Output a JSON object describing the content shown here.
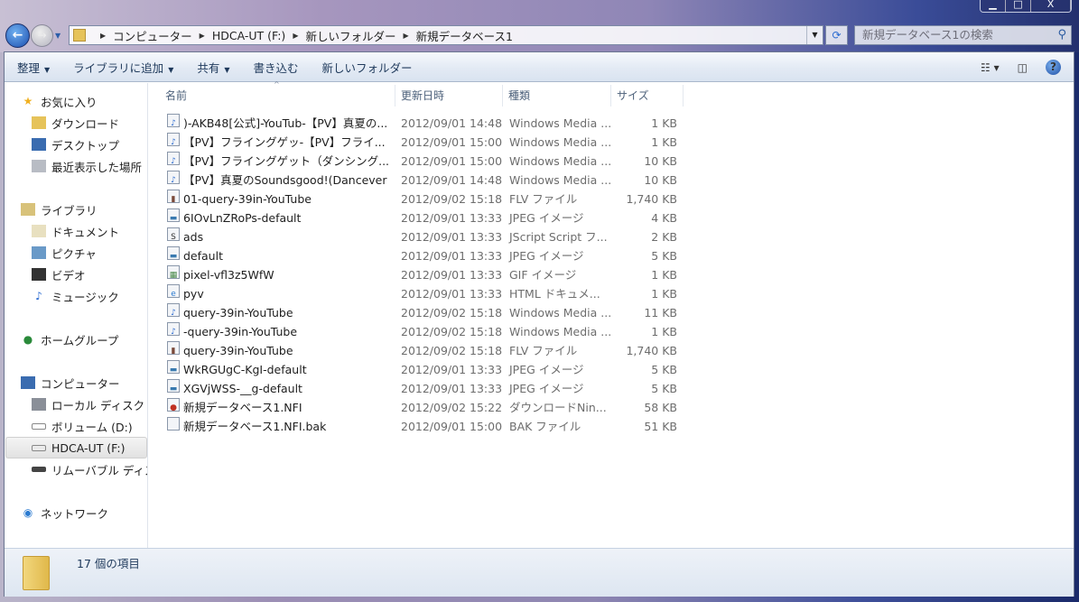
{
  "window": {
    "minimize": "▁",
    "maximize": "□",
    "close": "X"
  },
  "address": {
    "crumbs": [
      "コンピューター",
      "HDCA-UT (F:)",
      "新しいフォルダー",
      "新規データベース1"
    ]
  },
  "search": {
    "placeholder": "新規データベース1の検索"
  },
  "toolbar": {
    "organize": "整理",
    "add_library": "ライブラリに追加",
    "share": "共有",
    "burn": "書き込む",
    "new_folder": "新しいフォルダー"
  },
  "nav": {
    "favorites": "お気に入り",
    "downloads": "ダウンロード",
    "desktop": "デスクトップ",
    "recent": "最近表示した場所",
    "libraries": "ライブラリ",
    "documents": "ドキュメント",
    "pictures": "ピクチャ",
    "videos": "ビデオ",
    "music": "ミュージック",
    "homegroup": "ホームグループ",
    "computer": "コンピューター",
    "local_disk": "ローカル ディスク (",
    "volume_d": "ボリューム (D:)",
    "hdca": "HDCA-UT (F:)",
    "removable": "リムーバブル ディス",
    "network": "ネットワーク"
  },
  "columns": {
    "name": "名前",
    "date": "更新日時",
    "type": "種類",
    "size": "サイズ"
  },
  "files": [
    {
      "icon": "wmp",
      "name": ")-AKB48[公式]-YouTub-【PV】真夏の...",
      "date": "2012/09/01 14:48",
      "type": "Windows Media ...",
      "size": "1 KB"
    },
    {
      "icon": "wmp",
      "name": "【PV】フライングゲッ-【PV】フライ...",
      "date": "2012/09/01 15:00",
      "type": "Windows Media ...",
      "size": "1 KB"
    },
    {
      "icon": "wmp",
      "name": "【PV】フライングゲット（ダンシング...",
      "date": "2012/09/01 15:00",
      "type": "Windows Media ...",
      "size": "10 KB"
    },
    {
      "icon": "wmp",
      "name": "【PV】真夏のSoundsgood!(Dancever",
      "date": "2012/09/01 14:48",
      "type": "Windows Media ...",
      "size": "10 KB"
    },
    {
      "icon": "flv",
      "name": "01-query-39in-YouTube",
      "date": "2012/09/02 15:18",
      "type": "FLV ファイル",
      "size": "1,740 KB"
    },
    {
      "icon": "jpeg",
      "name": "6IOvLnZRoPs-default",
      "date": "2012/09/01 13:33",
      "type": "JPEG イメージ",
      "size": "4 KB"
    },
    {
      "icon": "js",
      "name": "ads",
      "date": "2012/09/01 13:33",
      "type": "JScript Script フ...",
      "size": "2 KB"
    },
    {
      "icon": "jpeg",
      "name": "default",
      "date": "2012/09/01 13:33",
      "type": "JPEG イメージ",
      "size": "5 KB"
    },
    {
      "icon": "gif",
      "name": "pixel-vfl3z5WfW",
      "date": "2012/09/01 13:33",
      "type": "GIF イメージ",
      "size": "1 KB"
    },
    {
      "icon": "html",
      "name": "pyv",
      "date": "2012/09/01 13:33",
      "type": "HTML ドキュメ...",
      "size": "1 KB"
    },
    {
      "icon": "wmp",
      "name": "query-39in-YouTube",
      "date": "2012/09/02 15:18",
      "type": "Windows Media ...",
      "size": "11 KB"
    },
    {
      "icon": "wmp",
      "name": "-query-39in-YouTube",
      "date": "2012/09/02 15:18",
      "type": "Windows Media ...",
      "size": "1 KB"
    },
    {
      "icon": "flv",
      "name": "query-39in-YouTube",
      "date": "2012/09/02 15:18",
      "type": "FLV ファイル",
      "size": "1,740 KB"
    },
    {
      "icon": "jpeg",
      "name": "WkRGUgC-KgI-default",
      "date": "2012/09/01 13:33",
      "type": "JPEG イメージ",
      "size": "5 KB"
    },
    {
      "icon": "jpeg",
      "name": "XGVjWSS-__g-default",
      "date": "2012/09/01 13:33",
      "type": "JPEG イメージ",
      "size": "5 KB"
    },
    {
      "icon": "nfi",
      "name": "新規データベース1.NFI",
      "date": "2012/09/02 15:22",
      "type": "ダウンロードNin...",
      "size": "58 KB"
    },
    {
      "icon": "bak",
      "name": "新規データベース1.NFI.bak",
      "date": "2012/09/01 15:00",
      "type": "BAK ファイル",
      "size": "51 KB"
    }
  ],
  "status": {
    "count": "17 個の項目"
  }
}
